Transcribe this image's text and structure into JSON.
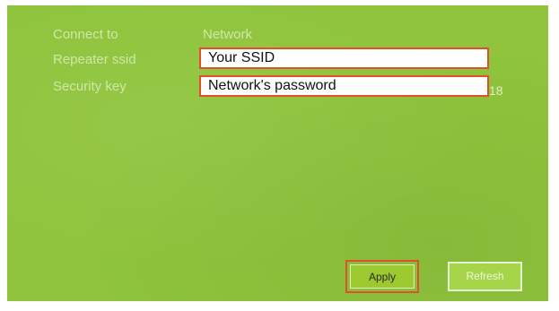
{
  "form": {
    "connect_to_label": "Connect to",
    "connect_to_value": "Network",
    "repeater_ssid_label": "Repeater ssid",
    "repeater_ssid_value": "Your SSID",
    "security_key_label": "Security key",
    "security_key_value": "Network's password",
    "security_key_length": "18"
  },
  "buttons": {
    "apply_label": "Apply",
    "refresh_label": "Refresh"
  },
  "colors": {
    "panel_background": "#8fc43c",
    "label_text": "#cfe8a8",
    "highlight_border": "#e0502a"
  }
}
